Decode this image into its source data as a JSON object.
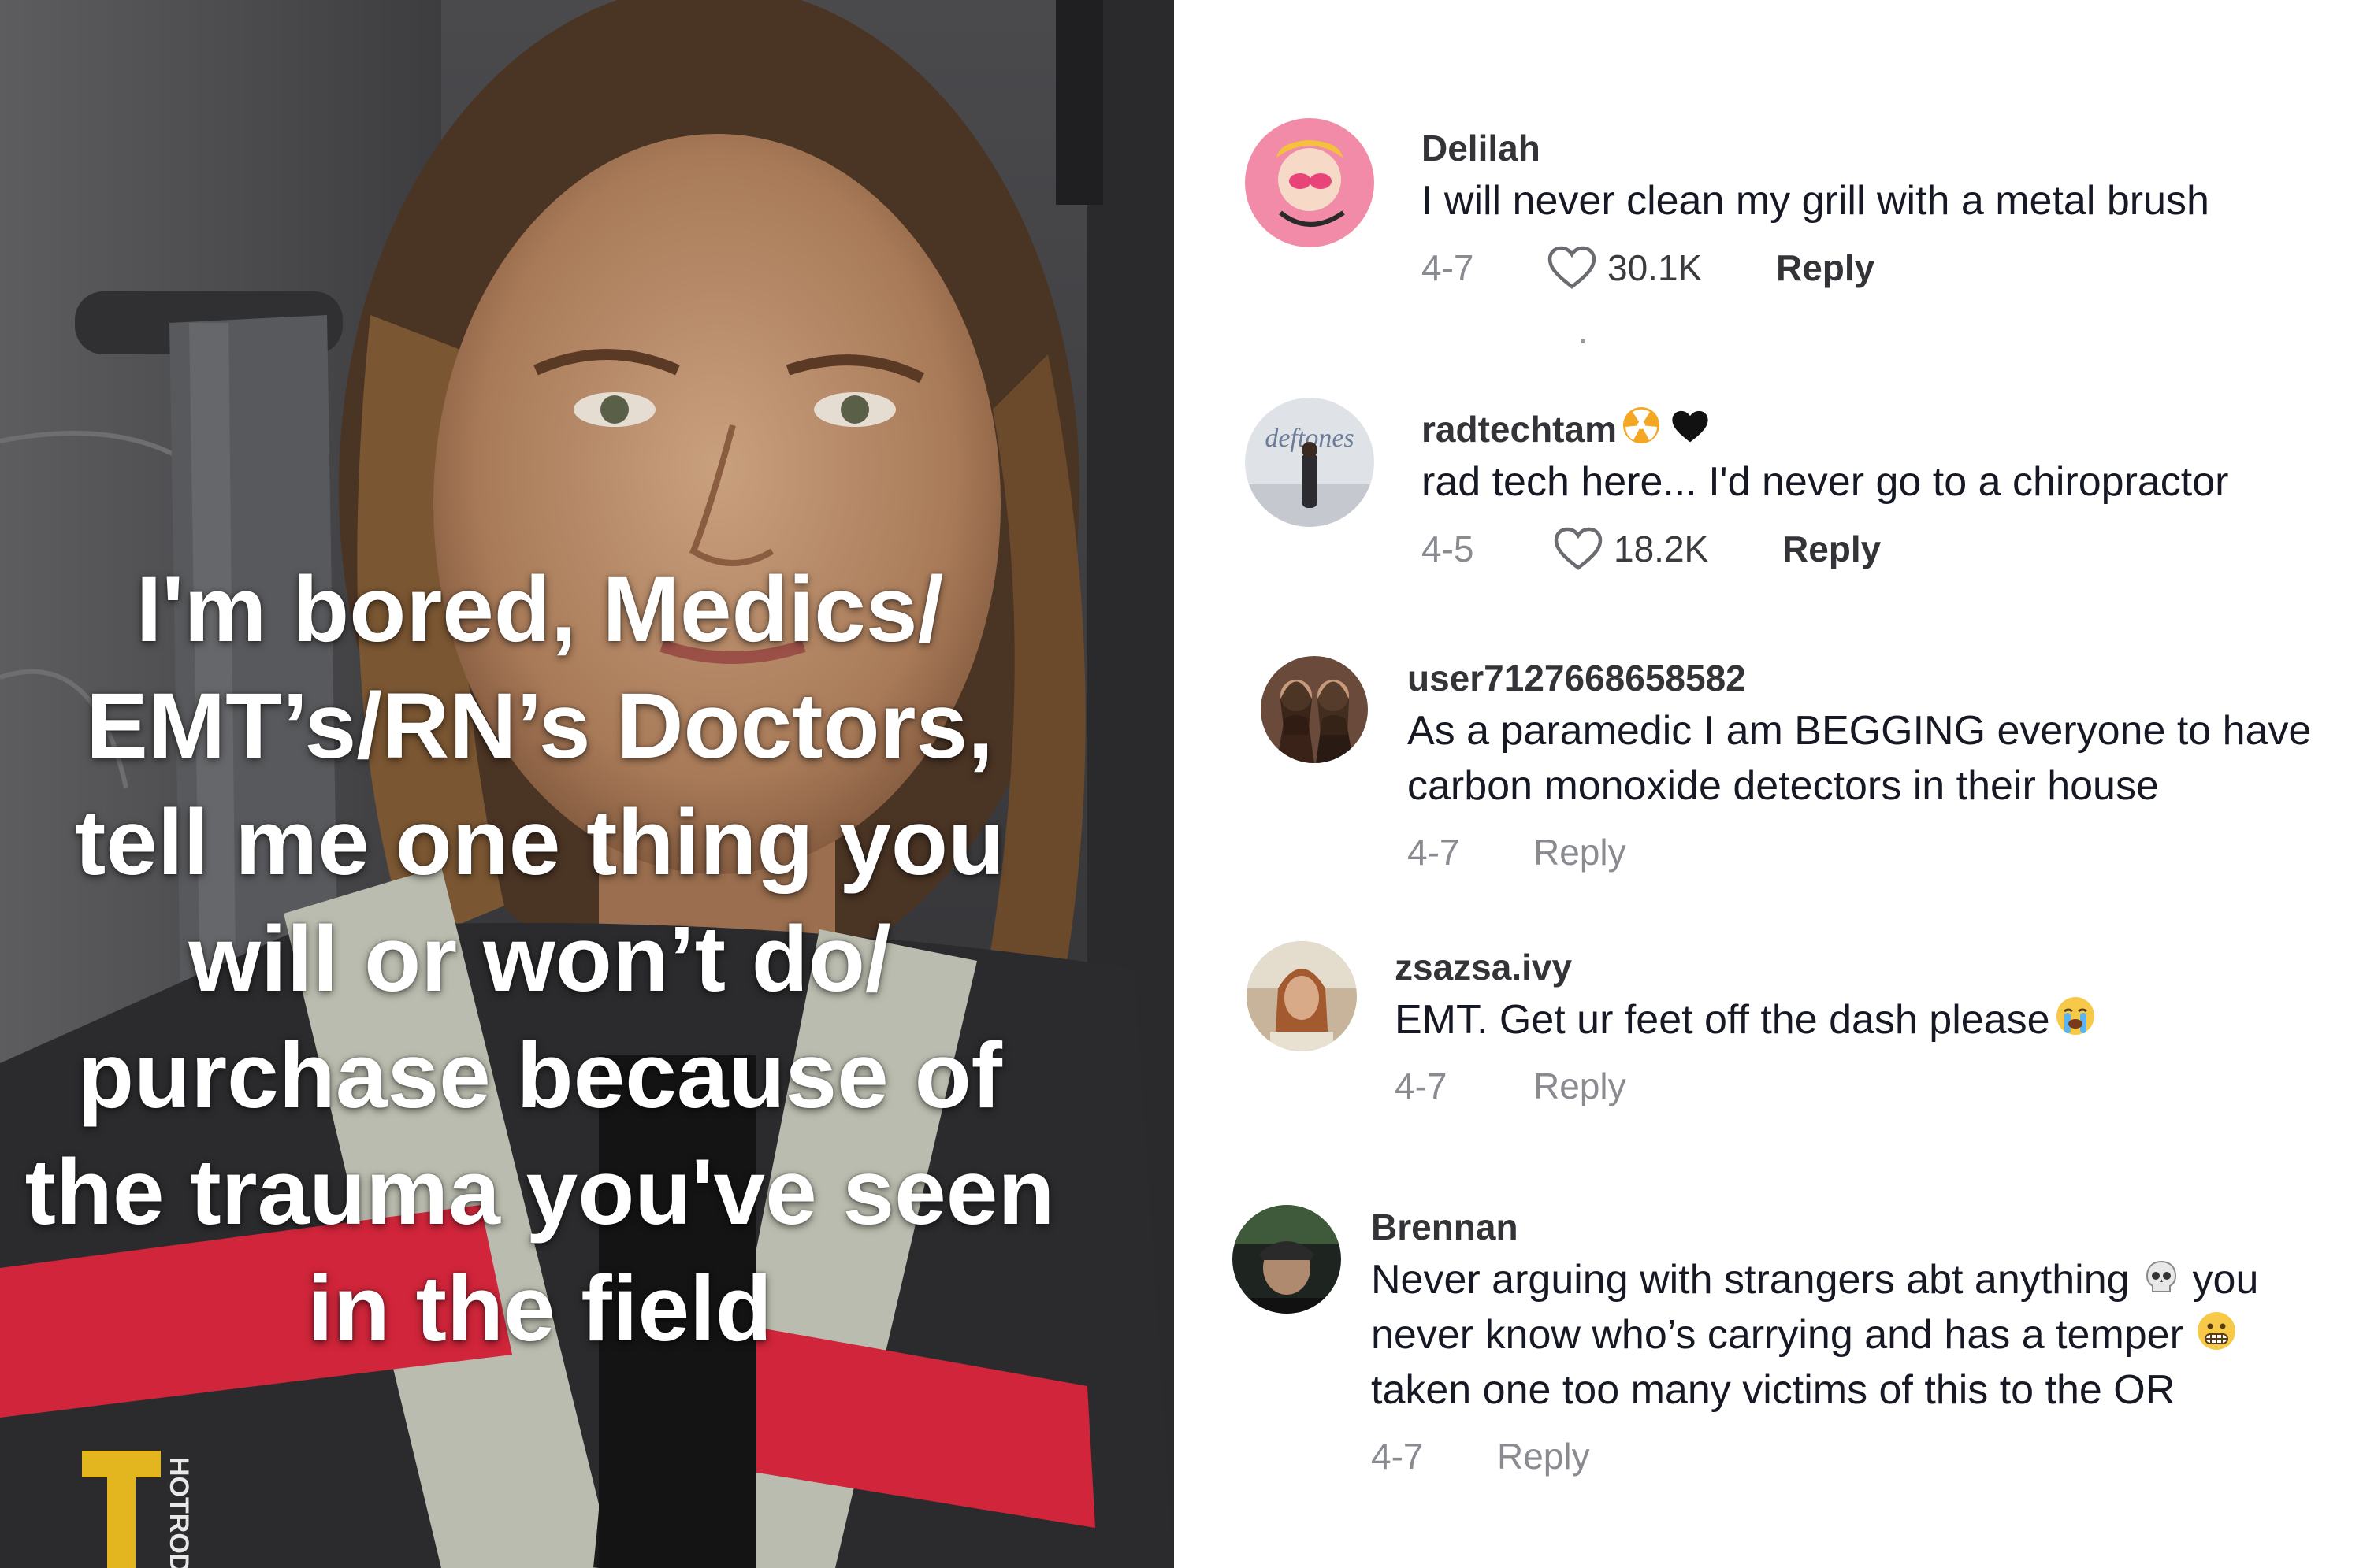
{
  "video": {
    "caption_lines": [
      "I'm bored, Medics/",
      "EMT’s/RN’s Doctors,",
      "tell me one thing you",
      "will or won’t do/",
      "purchase because of",
      "the trauma you've seen",
      "in the field"
    ],
    "logo_letter": "T",
    "logo_text": "HOTROD"
  },
  "comments": [
    {
      "username": "Delilah",
      "text_lines": [
        "I will never clean my grill with a metal brush"
      ],
      "date": "4-7",
      "likes": "30.1K",
      "reply_label": "Reply"
    },
    {
      "username": "radtechtam",
      "username_emojis": [
        "radioactive-emoji",
        "black-heart-emoji"
      ],
      "avatar_text": "deftones",
      "text_lines": [
        "rad tech here... I'd never go to a chiropractor"
      ],
      "date": "4-5",
      "likes": "18.2K",
      "reply_label": "Reply"
    },
    {
      "username": "user7127668658582",
      "text_lines": [
        "As a paramedic I am BEGGING everyone to have",
        "carbon monoxide detectors in their house"
      ],
      "date": "4-7",
      "reply_label": "Reply"
    },
    {
      "username": "zsazsa.ivy",
      "text_lines": [
        "EMT. Get ur feet off the dash please"
      ],
      "text_emoji": "loudly-crying-face-emoji",
      "date": "4-7",
      "reply_label": "Reply"
    },
    {
      "username": "Brennan",
      "text_lines": [
        "Never arguing with strangers abt anything",
        "you",
        "never know who’s carrying and has a temper",
        "taken one too many victims of this to the OR"
      ],
      "line_emojis": [
        "skull-emoji",
        "grimacing-face-emoji"
      ],
      "date": "4-7",
      "reply_label": "Reply"
    }
  ],
  "colors": {
    "text_primary": "#161823",
    "text_secondary": "#8a8b91",
    "vest_red": "#d0253a",
    "vest_reflective": "#b9bcae"
  }
}
